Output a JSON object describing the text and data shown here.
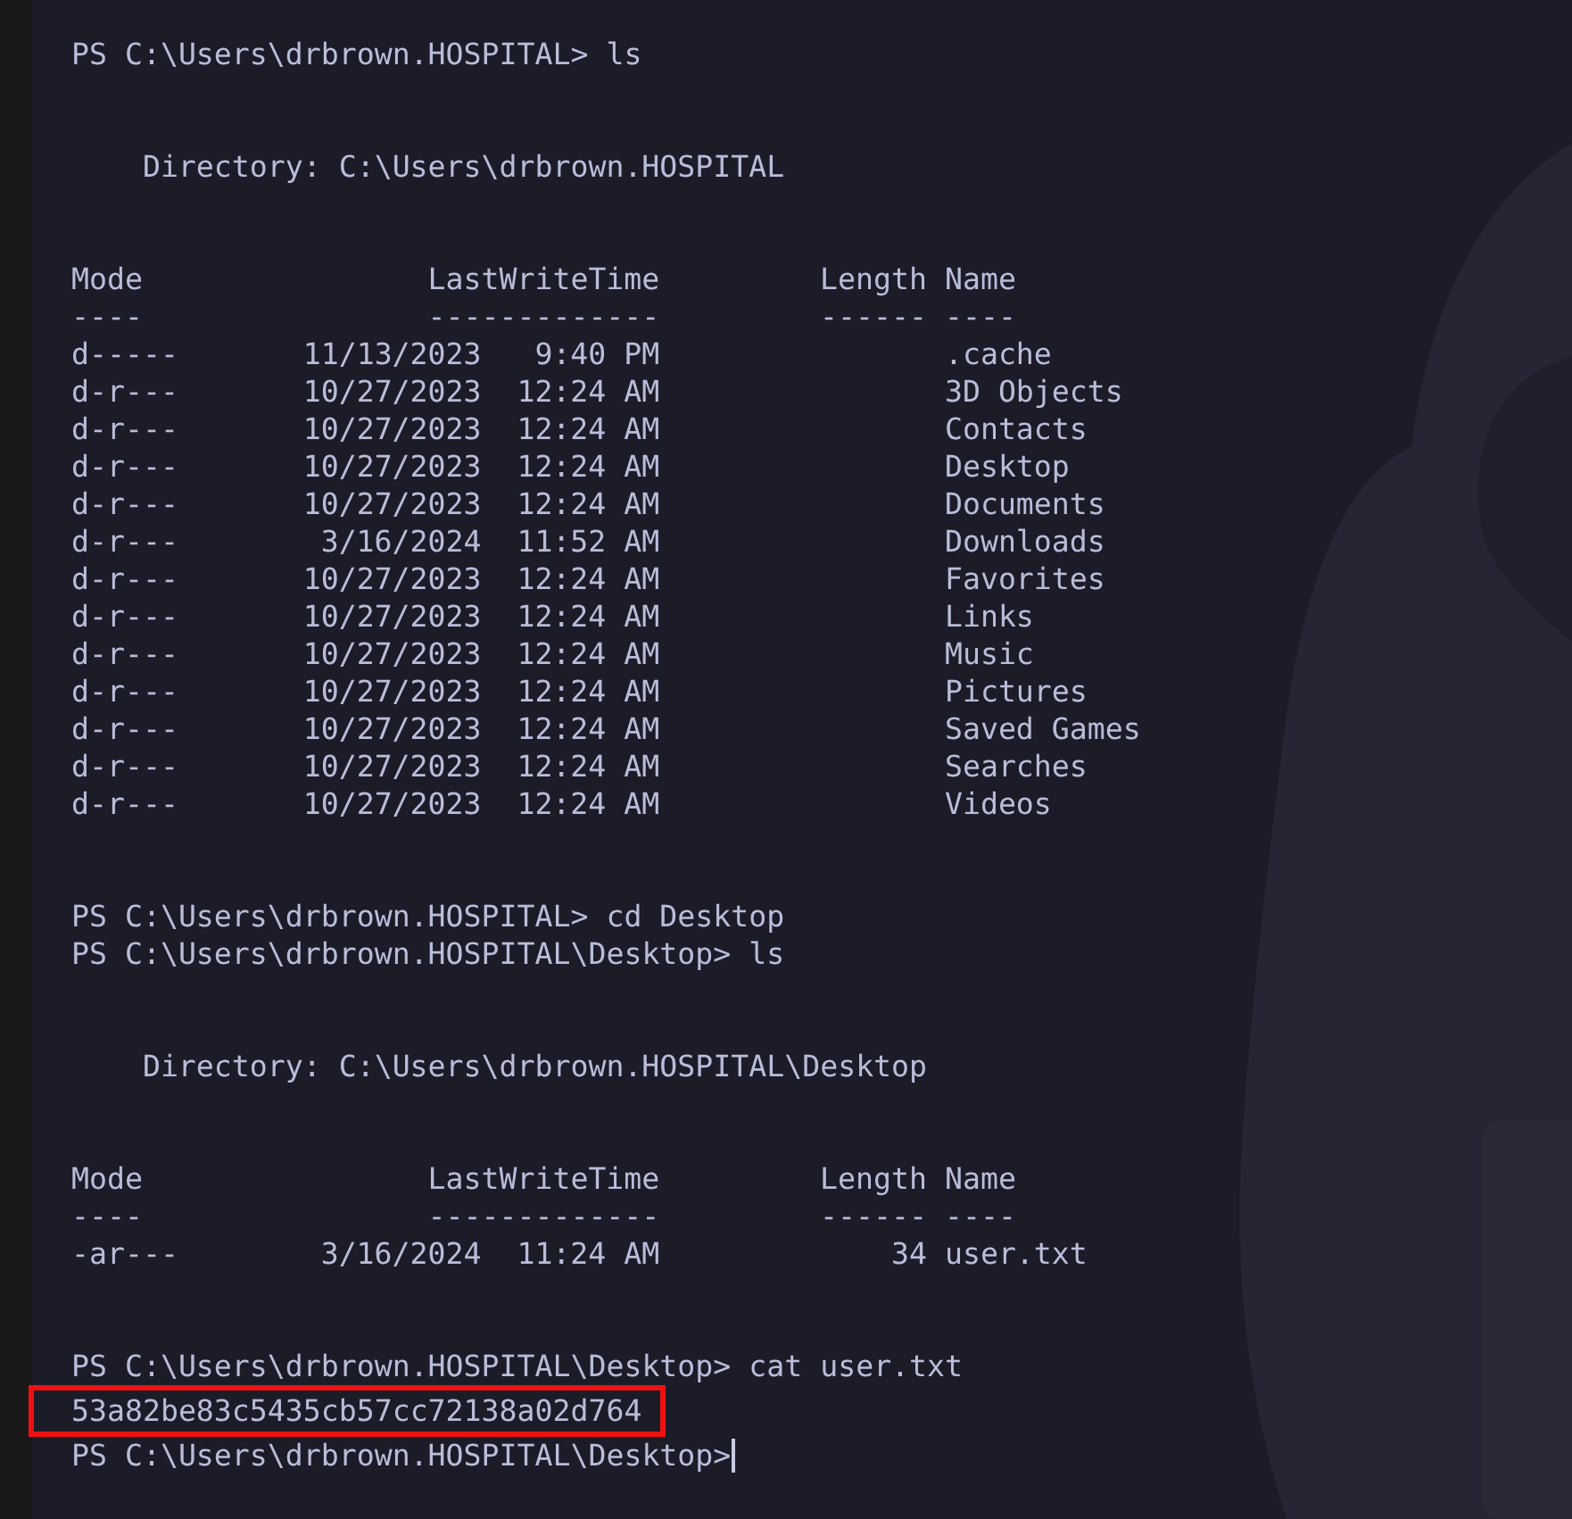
{
  "terminal": {
    "blocks": [
      {
        "kind": "command",
        "prompt": "PS C:\\Users\\drbrown.HOSPITAL>",
        "command": "ls"
      },
      {
        "kind": "listing",
        "directory_label": "Directory:",
        "directory": "C:\\Users\\drbrown.HOSPITAL",
        "columns": [
          {
            "label": "Mode",
            "rule": "----"
          },
          {
            "label": "LastWriteTime",
            "rule": "-------------"
          },
          {
            "label": "Length",
            "rule": "------"
          },
          {
            "label": "Name",
            "rule": "----"
          }
        ],
        "rows": [
          {
            "mode": "d-----",
            "date": "11/13/2023",
            "time": "9:40 PM",
            "name": ".cache"
          },
          {
            "mode": "d-r---",
            "date": "10/27/2023",
            "time": "12:24 AM",
            "name": "3D Objects"
          },
          {
            "mode": "d-r---",
            "date": "10/27/2023",
            "time": "12:24 AM",
            "name": "Contacts"
          },
          {
            "mode": "d-r---",
            "date": "10/27/2023",
            "time": "12:24 AM",
            "name": "Desktop"
          },
          {
            "mode": "d-r---",
            "date": "10/27/2023",
            "time": "12:24 AM",
            "name": "Documents"
          },
          {
            "mode": "d-r---",
            "date": "3/16/2024",
            "time": "11:52 AM",
            "name": "Downloads"
          },
          {
            "mode": "d-r---",
            "date": "10/27/2023",
            "time": "12:24 AM",
            "name": "Favorites"
          },
          {
            "mode": "d-r---",
            "date": "10/27/2023",
            "time": "12:24 AM",
            "name": "Links"
          },
          {
            "mode": "d-r---",
            "date": "10/27/2023",
            "time": "12:24 AM",
            "name": "Music"
          },
          {
            "mode": "d-r---",
            "date": "10/27/2023",
            "time": "12:24 AM",
            "name": "Pictures"
          },
          {
            "mode": "d-r---",
            "date": "10/27/2023",
            "time": "12:24 AM",
            "name": "Saved Games"
          },
          {
            "mode": "d-r---",
            "date": "10/27/2023",
            "time": "12:24 AM",
            "name": "Searches"
          },
          {
            "mode": "d-r---",
            "date": "10/27/2023",
            "time": "12:24 AM",
            "name": "Videos"
          }
        ]
      },
      {
        "kind": "command",
        "prompt": "PS C:\\Users\\drbrown.HOSPITAL>",
        "command": "cd Desktop"
      },
      {
        "kind": "command",
        "prompt": "PS C:\\Users\\drbrown.HOSPITAL\\Desktop>",
        "command": "ls"
      },
      {
        "kind": "listing",
        "directory_label": "Directory:",
        "directory": "C:\\Users\\drbrown.HOSPITAL\\Desktop",
        "columns": [
          {
            "label": "Mode",
            "rule": "----"
          },
          {
            "label": "LastWriteTime",
            "rule": "-------------"
          },
          {
            "label": "Length",
            "rule": "------"
          },
          {
            "label": "Name",
            "rule": "----"
          }
        ],
        "rows": [
          {
            "mode": "-ar---",
            "date": "3/16/2024",
            "time": "11:24 AM",
            "length": "34",
            "name": "user.txt"
          }
        ]
      },
      {
        "kind": "command",
        "prompt": "PS C:\\Users\\drbrown.HOSPITAL\\Desktop>",
        "command": "cat user.txt"
      },
      {
        "kind": "output",
        "text": "53a82be83c5435cb57cc72138a02d764"
      },
      {
        "kind": "input",
        "prompt": "PS C:\\Users\\drbrown.HOSPITAL\\Desktop>"
      }
    ]
  }
}
